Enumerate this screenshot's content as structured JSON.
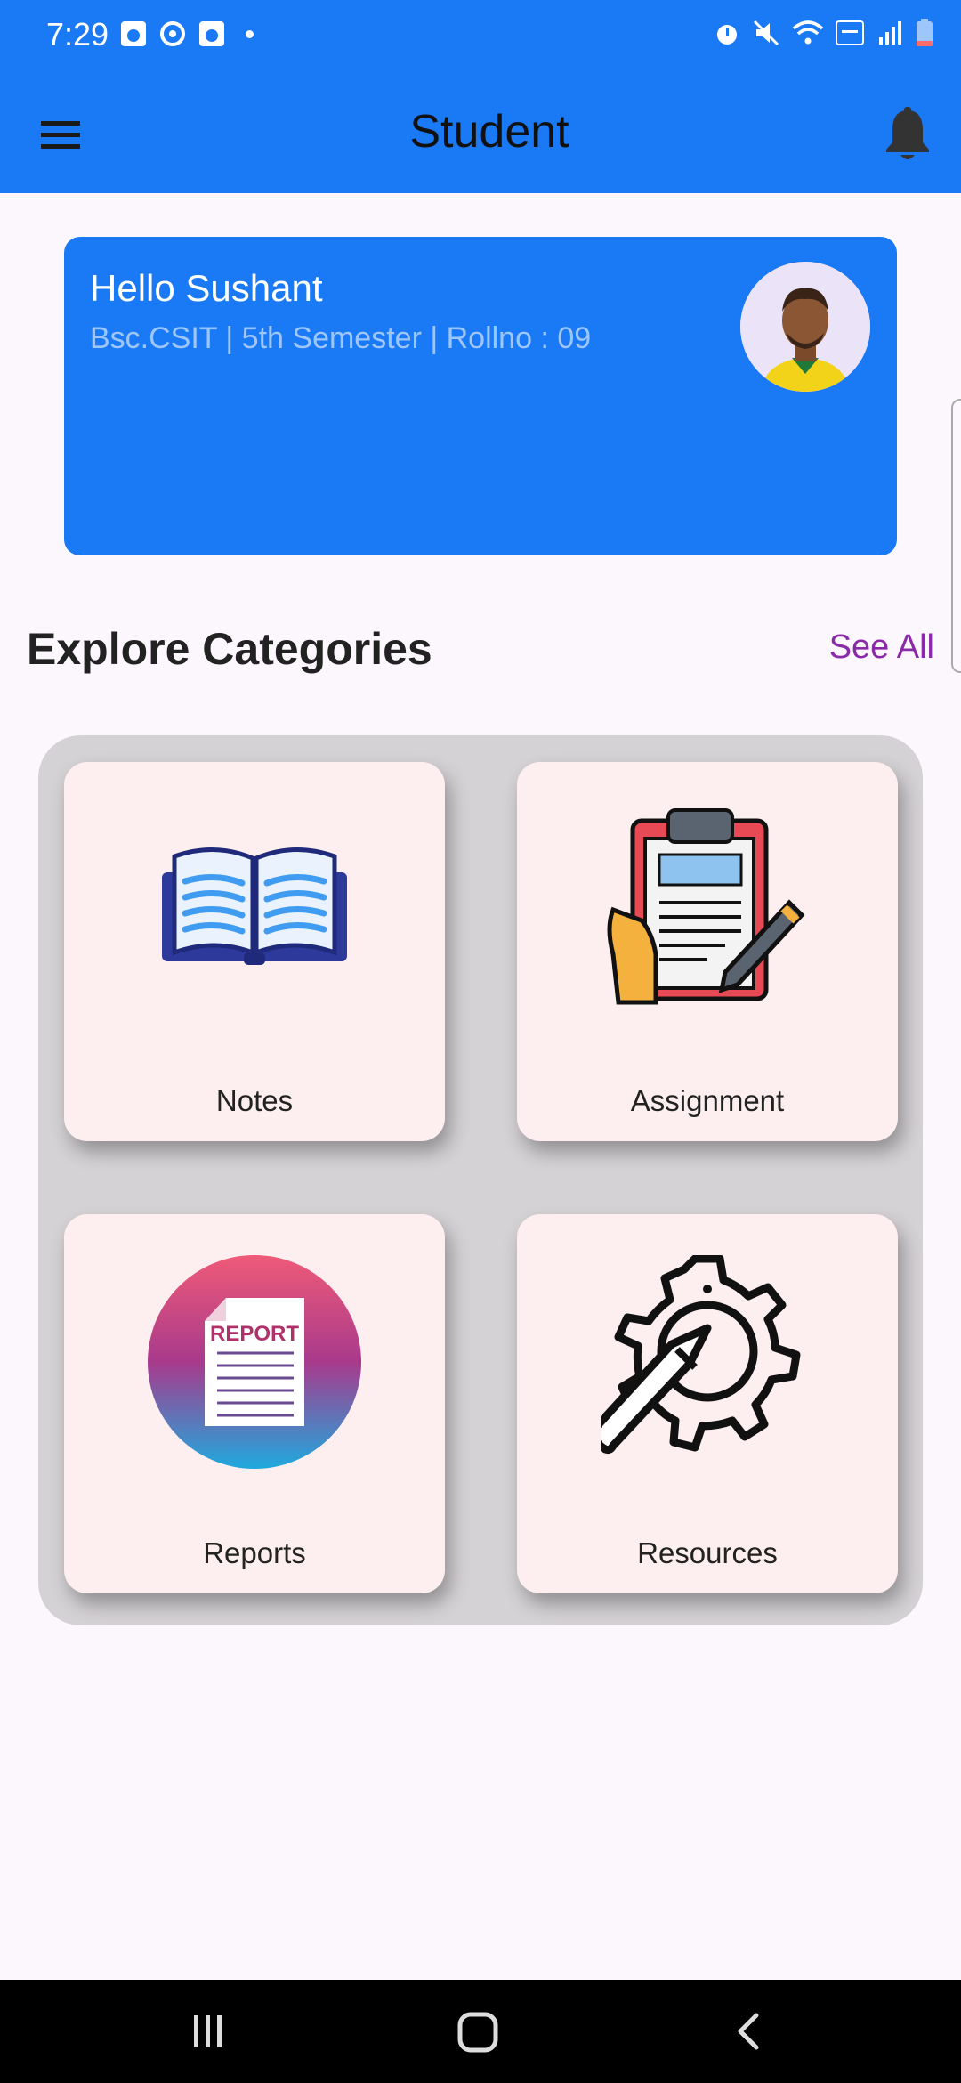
{
  "status_bar": {
    "time": "7:29"
  },
  "app_bar": {
    "title": "Student"
  },
  "profile_card": {
    "greeting": "Hello Sushant",
    "details": "Bsc.CSIT | 5th Semester | Rollno : 09"
  },
  "section": {
    "title": "Explore Categories",
    "see_all": "See All"
  },
  "categories": [
    {
      "label": "Notes",
      "icon": "open-book-icon"
    },
    {
      "label": "Assignment",
      "icon": "clipboard-pencil-icon"
    },
    {
      "label": "Reports",
      "icon": "report-document-icon"
    },
    {
      "label": "Resources",
      "icon": "gear-pencil-icon"
    }
  ],
  "colors": {
    "primary": "#1a7af5",
    "accent": "#8a2aa8",
    "card": "#fdefef"
  }
}
